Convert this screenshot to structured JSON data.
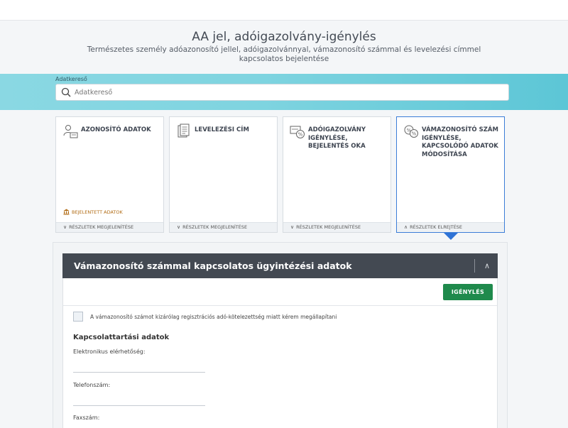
{
  "header": {
    "title": "AA jel, adóigazolvány-igénylés",
    "subtitle": "Természetes személy adóazonosító jellel, adóigazolvánnyal, vámazonosító számmal és levelezési címmel kapcsolatos bejelentése"
  },
  "search": {
    "label": "Adatkereső",
    "placeholder": "Adatkereső"
  },
  "cards": [
    {
      "title": "AZONOSÍTÓ ADATOK",
      "icon": "person-id-icon",
      "badge": "BEJELENTETT ADATOK",
      "footer": "RÉSZLETEK MEGJELENÍTÉSE",
      "expanded": false
    },
    {
      "title": "LEVELEZÉSI CÍM",
      "icon": "document-icon",
      "badge": "",
      "footer": "RÉSZLETEK MEGJELENÍTÉSE",
      "expanded": false
    },
    {
      "title": "ADÓIGAZOLVÁNY IGÉNYLÉSE, BEJELENTÉS OKA",
      "icon": "tax-card-icon",
      "badge": "",
      "footer": "RÉSZLETEK MEGJELENÍTÉSE",
      "expanded": false
    },
    {
      "title": "VÁMAZONOSÍTÓ SZÁM IGÉNYLÉSE, KAPCSOLÓDÓ ADATOK MÓDOSÍTÁSA",
      "icon": "customs-id-icon",
      "badge": "",
      "footer": "RÉSZLETEK ELREJTÉSE",
      "expanded": true
    }
  ],
  "section": {
    "title": "Vámazonosító számmal kapcsolatos ügyintézési adatok",
    "action_label": "IGÉNYLÉS",
    "checkbox_label": "A vámazonosító számot kizárólag regisztrációs adó-kötelezettség miatt kérem megállapítani",
    "checkbox_checked": false,
    "contact": {
      "heading": "Kapcsolattartási adatok",
      "fields": [
        {
          "label": "Elektronikus elérhetőség:",
          "value": ""
        },
        {
          "label": "Telefonszám:",
          "value": ""
        },
        {
          "label": "Faxszám:",
          "value": ""
        }
      ]
    }
  },
  "colors": {
    "accent_blue": "#2f73d6",
    "button_green": "#1f8a4c",
    "header_dark": "#434952",
    "badge_orange": "#b06a12"
  }
}
